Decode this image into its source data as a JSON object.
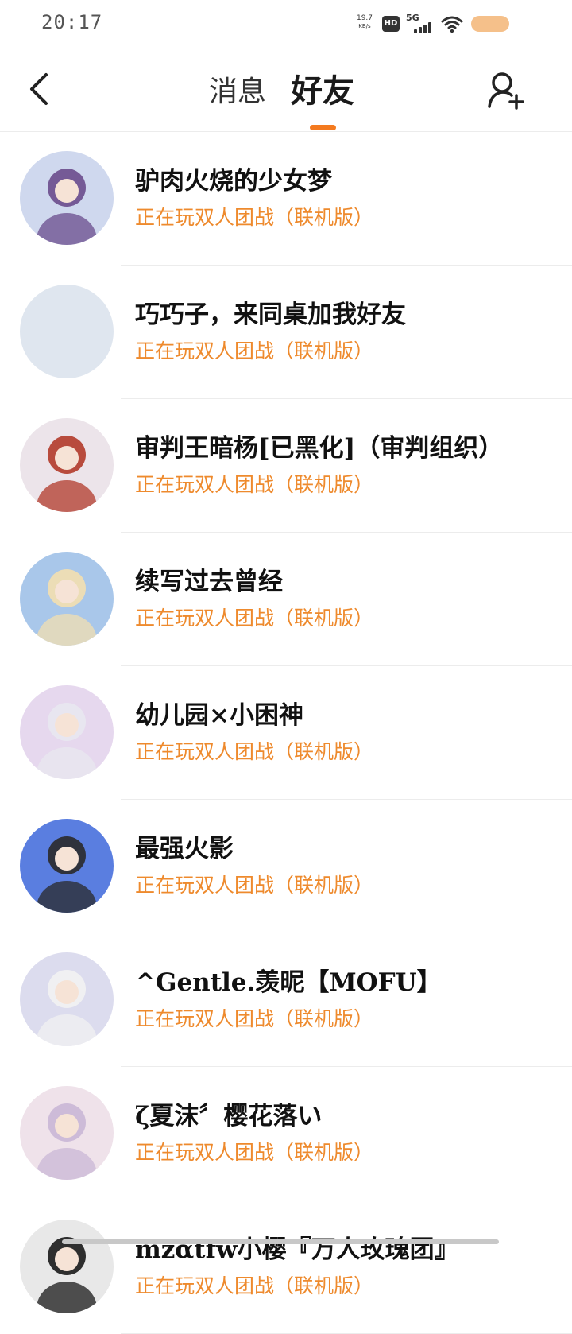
{
  "status_bar": {
    "time": "20:17",
    "net_speed_value": "19.7",
    "net_speed_unit": "KB/s",
    "hd_label": "HD",
    "network_label": "5G"
  },
  "header": {
    "tab_messages": "消息",
    "tab_friends": "好友",
    "back_icon": "chevron-left-icon",
    "add_icon": "add-user-icon",
    "accent_color": "#f47a1f"
  },
  "friends": [
    {
      "name": "驴肉火烧的少女梦",
      "status": "正在玩双人团战（联机版）",
      "avatar_color": "#6a4c8c",
      "avatar_bg": "#cfd8ee"
    },
    {
      "name": "巧巧子，来同桌加我好友",
      "status": "正在玩双人团战（联机版）",
      "avatar_color": "#dfe6ef",
      "avatar_bg": "#dfe6ef"
    },
    {
      "name": "审判王暗杨[已黑化]（审判组织）",
      "status": "正在玩双人团战（联机版）",
      "avatar_color": "#b23a2a",
      "avatar_bg": "#ece4ea"
    },
    {
      "name": "续写过去曾经",
      "status": "正在玩双人团战（联机版）",
      "avatar_color": "#f3dfb0",
      "avatar_bg": "#a9c7ea"
    },
    {
      "name": "幼儿园×小困神",
      "status": "正在玩双人团战（联机版）",
      "avatar_color": "#e8e8ef",
      "avatar_bg": "#e6d8ee"
    },
    {
      "name": "最强火影",
      "status": "正在玩双人团战（联机版）",
      "avatar_color": "#2a2a2a",
      "avatar_bg": "#5a7ee0"
    },
    {
      "name": "^Gentle.羡昵【MOFU】",
      "status": "正在玩双人团战（联机版）",
      "avatar_color": "#f2f2f2",
      "avatar_bg": "#dcdcee"
    },
    {
      "name": "ζ夏沫〞樱花落い",
      "status": "正在玩双人团战（联机版）",
      "avatar_color": "#c9b7d6",
      "avatar_bg": "#efe2ea"
    },
    {
      "name": "mzαtfw小樱『万人玫瑰团』",
      "status": "正在玩双人团战（联机版）",
      "avatar_color": "#1a1a1a",
      "avatar_bg": "#e8e8e8"
    }
  ]
}
